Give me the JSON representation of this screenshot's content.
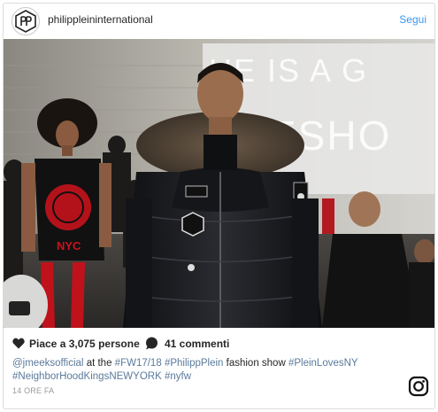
{
  "post": {
    "username": "philippleininternational",
    "follow_label": "Segui",
    "likes_text": "Piace a 3,075 persone",
    "comments_text": "41 commenti",
    "caption": {
      "mention": "@jmeeksofficial",
      "at_text": " at the ",
      "tag1": "#FW17/18",
      "sp1": " ",
      "tag2": "#PhilippPlein",
      "mid_text": " fashion show ",
      "tag3": "#PleinLovesNY",
      "sp2": " ",
      "tag4": "#NeighborHoodKingsNEWYORK",
      "sp3": " ",
      "tag5": "#nyfw"
    },
    "timestamp": "14 ORE FA",
    "photo_sign": {
      "line1": "HE IS A G",
      "line2": "ESHO"
    },
    "shirt_text": "NYC"
  },
  "colors": {
    "link": "#3897f0",
    "hashtag": "#3b5b82",
    "text": "#262626",
    "muted": "#999999",
    "border": "#dbdbdb"
  },
  "icons": {
    "avatar": "philipp-plein-logo-icon",
    "like": "heart-icon",
    "comment": "comment-bubble-icon",
    "brand": "instagram-icon"
  }
}
